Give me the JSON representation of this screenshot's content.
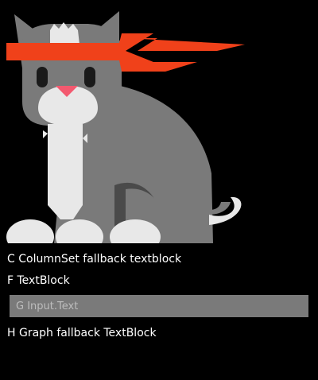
{
  "hero_image": {
    "subject": "ninja-cat-icon",
    "colors": {
      "fur": "#7a7a7a",
      "fur_light": "#e8e8e8",
      "headband": "#f0411a",
      "nose": "#f3596f",
      "eyes": "#1a1a1a",
      "shadow": "#4a4a4a"
    }
  },
  "blocks": {
    "columnset_fallback": "C ColumnSet fallback textblock",
    "textblock": "F TextBlock",
    "input_placeholder": "G Input.Text",
    "graph_fallback": "H Graph fallback TextBlock"
  }
}
